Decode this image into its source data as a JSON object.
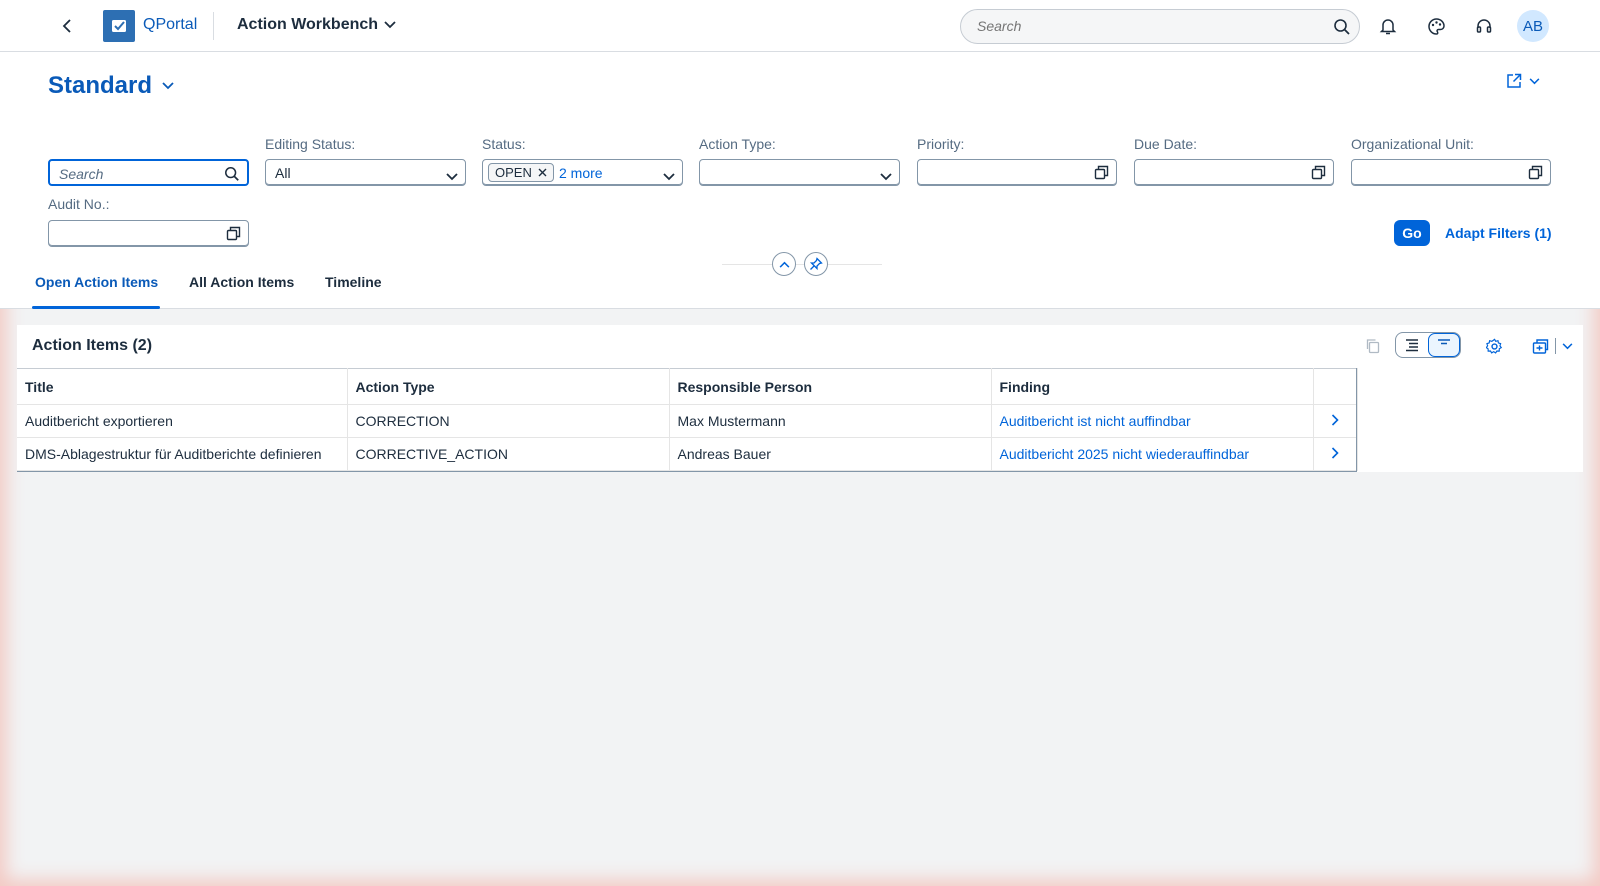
{
  "shell": {
    "brand": "QPortal",
    "app_title": "Action Workbench",
    "search_placeholder": "Search",
    "avatar_initials": "AB"
  },
  "header": {
    "variant_name": "Standard"
  },
  "filters": {
    "search_placeholder": "Search",
    "editing_status": {
      "label": "Editing Status:",
      "value": "All"
    },
    "status": {
      "label": "Status:",
      "token": "OPEN",
      "more": "2 more"
    },
    "action_type": {
      "label": "Action Type:",
      "value": ""
    },
    "priority": {
      "label": "Priority:",
      "value": ""
    },
    "due_date": {
      "label": "Due Date:",
      "value": ""
    },
    "org_unit": {
      "label": "Organizational Unit:",
      "value": ""
    },
    "audit_no": {
      "label": "Audit No.:",
      "value": ""
    },
    "go_label": "Go",
    "adapt_label": "Adapt Filters (1)"
  },
  "tabs": [
    {
      "label": "Open Action Items",
      "active": true
    },
    {
      "label": "All Action Items",
      "active": false
    },
    {
      "label": "Timeline",
      "active": false
    }
  ],
  "table": {
    "title": "Action Items (2)",
    "columns": [
      "Title",
      "Action Type",
      "Responsible Person",
      "Finding"
    ],
    "rows": [
      [
        "Auditbericht exportieren",
        "CORRECTION",
        "Max Mustermann",
        "Auditbericht ist nicht auffindbar"
      ],
      [
        "DMS-Ablagestruktur für Auditberichte definieren",
        "CORRECTIVE_ACTION",
        "Andreas Bauer",
        "Auditbericht 2025 nicht wiederauffindbar"
      ]
    ]
  },
  "colors": {
    "accent": "#0064d9",
    "brand_blue": "#0a5ab8",
    "text": "#1d2d3e"
  }
}
